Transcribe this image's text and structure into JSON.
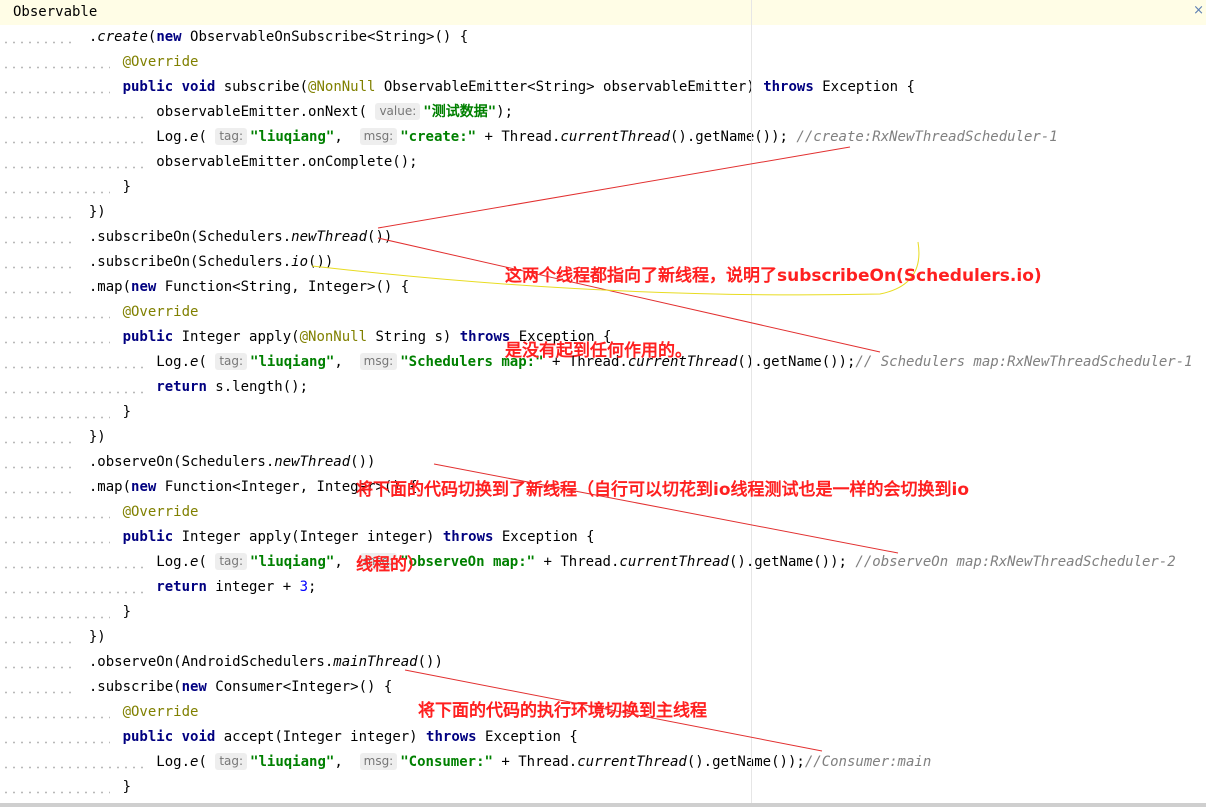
{
  "editor": {
    "accent_current_line": "#fffde6",
    "colors": {
      "keyword": "#000080",
      "string": "#008000",
      "annotation": "#808000",
      "comment": "#808080",
      "number": "#0000ff",
      "note": "#ff2020"
    },
    "lines": [
      {
        "indent": 0,
        "current": true,
        "segs": [
          {
            "t": "Observable"
          }
        ]
      },
      {
        "indent": 9,
        "segs": [
          {
            "t": "."
          },
          {
            "t": "create",
            "c": "it"
          },
          {
            "t": "("
          },
          {
            "t": "new",
            "c": "kw"
          },
          {
            "t": " ObservableOnSubscribe<String>() {"
          }
        ]
      },
      {
        "indent": 13,
        "segs": [
          {
            "t": "@Override",
            "c": "ann"
          }
        ]
      },
      {
        "indent": 13,
        "segs": [
          {
            "t": "public",
            "c": "kw"
          },
          {
            "t": " "
          },
          {
            "t": "void",
            "c": "kw"
          },
          {
            "t": " subscribe("
          },
          {
            "t": "@NonNull",
            "c": "ann"
          },
          {
            "t": " ObservableEmitter<String> observableEmitter) "
          },
          {
            "t": "throws",
            "c": "kw"
          },
          {
            "t": " Exception {"
          }
        ]
      },
      {
        "indent": 17,
        "segs": [
          {
            "t": "observableEmitter.onNext( "
          },
          {
            "t": "value:",
            "c": "hint"
          },
          {
            "t": "\"测试数据\"",
            "c": "str"
          },
          {
            "t": ");"
          }
        ]
      },
      {
        "indent": 17,
        "segs": [
          {
            "t": "Log."
          },
          {
            "t": "e",
            "c": "it"
          },
          {
            "t": "( "
          },
          {
            "t": "tag:",
            "c": "hint"
          },
          {
            "t": "\"liuqiang\"",
            "c": "str"
          },
          {
            "t": ",  "
          },
          {
            "t": "msg:",
            "c": "hint"
          },
          {
            "t": "\"create:\"",
            "c": "str"
          },
          {
            "t": " + Thread."
          },
          {
            "t": "currentThread",
            "c": "it"
          },
          {
            "t": "().getName()); "
          },
          {
            "t": "//create:RxNewThreadScheduler-1",
            "c": "cm"
          }
        ]
      },
      {
        "indent": 17,
        "segs": [
          {
            "t": "observableEmitter.onComplete();"
          }
        ]
      },
      {
        "indent": 13,
        "segs": [
          {
            "t": "}"
          }
        ]
      },
      {
        "indent": 9,
        "segs": [
          {
            "t": "})"
          }
        ]
      },
      {
        "indent": 9,
        "segs": [
          {
            "t": ".subscribeOn(Schedulers."
          },
          {
            "t": "newThread",
            "c": "it"
          },
          {
            "t": "())"
          }
        ]
      },
      {
        "indent": 9,
        "segs": [
          {
            "t": ".subscribeOn(Schedulers."
          },
          {
            "t": "io",
            "c": "it"
          },
          {
            "t": "())"
          }
        ]
      },
      {
        "indent": 9,
        "segs": [
          {
            "t": ".map("
          },
          {
            "t": "new",
            "c": "kw"
          },
          {
            "t": " Function<String, Integer>() {"
          }
        ]
      },
      {
        "indent": 13,
        "segs": [
          {
            "t": "@Override",
            "c": "ann"
          }
        ]
      },
      {
        "indent": 13,
        "segs": [
          {
            "t": "public",
            "c": "kw"
          },
          {
            "t": " Integer apply("
          },
          {
            "t": "@NonNull",
            "c": "ann"
          },
          {
            "t": " String s) "
          },
          {
            "t": "throws",
            "c": "kw"
          },
          {
            "t": " Exception {"
          }
        ]
      },
      {
        "indent": 17,
        "segs": [
          {
            "t": "Log."
          },
          {
            "t": "e",
            "c": "it"
          },
          {
            "t": "( "
          },
          {
            "t": "tag:",
            "c": "hint"
          },
          {
            "t": "\"liuqiang\"",
            "c": "str"
          },
          {
            "t": ",  "
          },
          {
            "t": "msg:",
            "c": "hint"
          },
          {
            "t": "\"Schedulers map:\"",
            "c": "str"
          },
          {
            "t": " + Thread."
          },
          {
            "t": "currentThread",
            "c": "it"
          },
          {
            "t": "().getName());"
          },
          {
            "t": "// Schedulers map:RxNewThreadScheduler-1",
            "c": "cm"
          }
        ]
      },
      {
        "indent": 17,
        "segs": [
          {
            "t": "return",
            "c": "kw"
          },
          {
            "t": " s.length();"
          }
        ]
      },
      {
        "indent": 13,
        "segs": [
          {
            "t": "}"
          }
        ]
      },
      {
        "indent": 9,
        "segs": [
          {
            "t": "})"
          }
        ]
      },
      {
        "indent": 9,
        "segs": [
          {
            "t": ".observeOn(Schedulers."
          },
          {
            "t": "newThread",
            "c": "it"
          },
          {
            "t": "())"
          }
        ]
      },
      {
        "indent": 9,
        "segs": [
          {
            "t": ".map("
          },
          {
            "t": "new",
            "c": "kw"
          },
          {
            "t": " Function<Integer, Integer>() {"
          }
        ]
      },
      {
        "indent": 13,
        "segs": [
          {
            "t": "@Override",
            "c": "ann"
          }
        ]
      },
      {
        "indent": 13,
        "segs": [
          {
            "t": "public",
            "c": "kw"
          },
          {
            "t": " Integer apply(Integer integer) "
          },
          {
            "t": "throws",
            "c": "kw"
          },
          {
            "t": " Exception {"
          }
        ]
      },
      {
        "indent": 17,
        "segs": [
          {
            "t": "Log."
          },
          {
            "t": "e",
            "c": "it"
          },
          {
            "t": "( "
          },
          {
            "t": "tag:",
            "c": "hint"
          },
          {
            "t": "\"liuqiang\"",
            "c": "str"
          },
          {
            "t": ",  "
          },
          {
            "t": "msg:",
            "c": "hint"
          },
          {
            "t": "\"observeOn map:\"",
            "c": "str"
          },
          {
            "t": " + Thread."
          },
          {
            "t": "currentThread",
            "c": "it"
          },
          {
            "t": "().getName()); "
          },
          {
            "t": "//observeOn map:RxNewThreadScheduler-2",
            "c": "cm"
          }
        ]
      },
      {
        "indent": 17,
        "segs": [
          {
            "t": "return",
            "c": "kw"
          },
          {
            "t": " integer + "
          },
          {
            "t": "3",
            "c": "num"
          },
          {
            "t": ";"
          }
        ]
      },
      {
        "indent": 13,
        "segs": [
          {
            "t": "}"
          }
        ]
      },
      {
        "indent": 9,
        "segs": [
          {
            "t": "})"
          }
        ]
      },
      {
        "indent": 9,
        "segs": [
          {
            "t": ".observeOn(AndroidSchedulers."
          },
          {
            "t": "mainThread",
            "c": "it"
          },
          {
            "t": "())"
          }
        ]
      },
      {
        "indent": 9,
        "segs": [
          {
            "t": ".subscribe("
          },
          {
            "t": "new",
            "c": "kw"
          },
          {
            "t": " Consumer<Integer>() {"
          }
        ]
      },
      {
        "indent": 13,
        "segs": [
          {
            "t": "@Override",
            "c": "ann"
          }
        ]
      },
      {
        "indent": 13,
        "segs": [
          {
            "t": "public",
            "c": "kw"
          },
          {
            "t": " "
          },
          {
            "t": "void",
            "c": "kw"
          },
          {
            "t": " accept(Integer integer) "
          },
          {
            "t": "throws",
            "c": "kw"
          },
          {
            "t": " Exception {"
          }
        ]
      },
      {
        "indent": 17,
        "segs": [
          {
            "t": "Log."
          },
          {
            "t": "e",
            "c": "it"
          },
          {
            "t": "( "
          },
          {
            "t": "tag:",
            "c": "hint"
          },
          {
            "t": "\"liuqiang\"",
            "c": "str"
          },
          {
            "t": ",  "
          },
          {
            "t": "msg:",
            "c": "hint"
          },
          {
            "t": "\"Consumer:\"",
            "c": "str"
          },
          {
            "t": " + Thread."
          },
          {
            "t": "currentThread",
            "c": "it"
          },
          {
            "t": "().getName());"
          },
          {
            "t": "//Consumer:main",
            "c": "cm"
          }
        ]
      },
      {
        "indent": 13,
        "segs": [
          {
            "t": "}"
          }
        ]
      }
    ]
  },
  "annotations": {
    "note1_line1": "这两个线程都指向了新线程，说明了subscribeOn(Schedulers.io)",
    "note1_line2": "是没有起到任何作用的。",
    "note2_line1": "将下面的代码切换到了新线程（自行可以切花到io线程测试也是一样的会切换到io",
    "note2_line2": "线程的）",
    "note3": "将下面的代码的执行环境切换到主线程"
  },
  "close_glyph": "×"
}
